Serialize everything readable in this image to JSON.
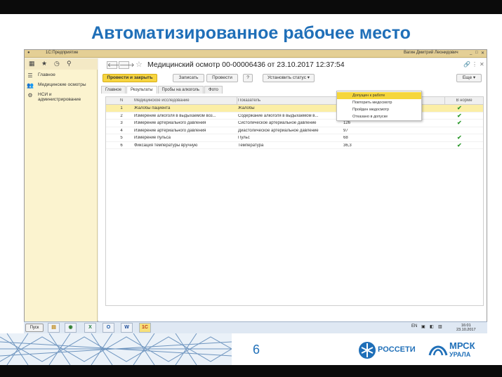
{
  "slide": {
    "title": "Автоматизированное рабочее место",
    "page_number": "6",
    "logos": {
      "rosseti": "РОССЕТИ",
      "mrsk_line1": "МРСК",
      "mrsk_line2": "УРАЛА"
    }
  },
  "window": {
    "title": "1С:Предприятие",
    "user": "Вагин Дмитрий Леонидович"
  },
  "sidebar": {
    "items": [
      {
        "label": "Главное",
        "icon": "menu-icon"
      },
      {
        "label": "Медицинские осмотры",
        "icon": "people-icon"
      },
      {
        "label": "НСИ и администрирование",
        "icon": "gear-icon"
      }
    ]
  },
  "document": {
    "title": "Медицинский осмотр 00-00006436 от 23.10.2017 12:37:54",
    "toolbar": {
      "post_close": "Провести и закрыть",
      "save": "Записать",
      "post": "Провести",
      "help": "?",
      "set_status": "Установить статус",
      "more": "Еще"
    },
    "tabs": [
      "Главное",
      "Результаты",
      "Пробы на алкоголь",
      "Фото"
    ],
    "status_menu": [
      "Допущен к работе",
      "Повторить медосмотр",
      "Пройден медосмотр",
      "Отказано в допуске"
    ],
    "table": {
      "headers": [
        "N",
        "Медицинское исследование",
        "Показатель",
        "Значение показателя",
        "В норме"
      ],
      "rows": [
        {
          "n": "1",
          "exam": "Жалобы пациента",
          "indicator": "Жалобы",
          "value": "нет",
          "ok": true
        },
        {
          "n": "2",
          "exam": "Измерение алкоголя в выдыхаемом воз...",
          "indicator": "Содержание алкоголя в выдыхаемом в...",
          "value": "0",
          "ok": true
        },
        {
          "n": "3",
          "exam": "Измерение артериального давления",
          "indicator": "Систолическое артериальное давление",
          "value": "126",
          "ok": true
        },
        {
          "n": "4",
          "exam": "Измерение артериального давления",
          "indicator": "Диастолическое артериальное давление",
          "value": "97",
          "ok": false
        },
        {
          "n": "5",
          "exam": "Измерение пульса",
          "indicator": "Пульс",
          "value": "68",
          "ok": true
        },
        {
          "n": "6",
          "exam": "Фиксация температуры вручную",
          "indicator": "Температура",
          "value": "36,3",
          "ok": true
        }
      ]
    }
  },
  "taskbar": {
    "start": "Пуск",
    "lang": "EN",
    "time": "16:01",
    "date": "23.10.2017"
  },
  "colors": {
    "accent": "#1f6fb8",
    "highlight": "#f5d63c",
    "sidebar": "#fbf3cf"
  }
}
